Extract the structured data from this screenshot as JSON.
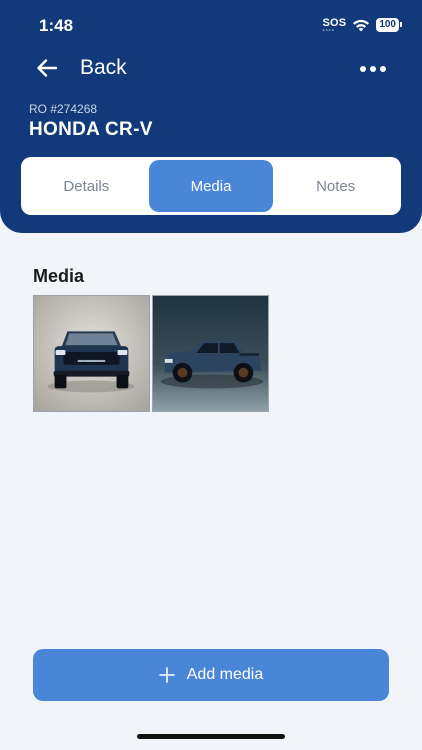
{
  "status_bar": {
    "time": "1:48",
    "sos": "SOS",
    "battery": "100"
  },
  "nav": {
    "back_label": "Back",
    "more_icon": "more-horizontal-icon"
  },
  "order": {
    "ro_number": "RO #274268",
    "vehicle": "HONDA CR-V"
  },
  "tabs": [
    {
      "label": "Details",
      "active": false
    },
    {
      "label": "Media",
      "active": true
    },
    {
      "label": "Notes",
      "active": false
    }
  ],
  "media": {
    "title": "Media",
    "items": [
      {
        "name": "truck-front-photo"
      },
      {
        "name": "truck-side-photo"
      }
    ]
  },
  "actions": {
    "add_media_label": "Add media"
  },
  "colors": {
    "header_bg": "#123a7a",
    "accent": "#4a86d8",
    "page_bg": "#f1f4f8"
  }
}
